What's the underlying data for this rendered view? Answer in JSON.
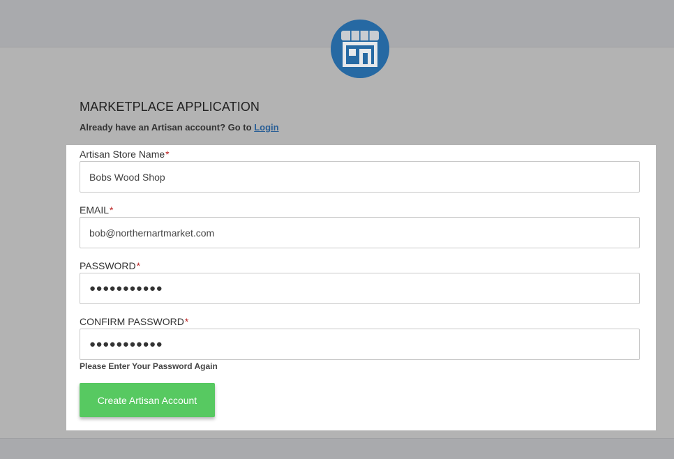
{
  "page": {
    "title": "MARKETPLACE APPLICATION",
    "login_prompt": "Already have an Artisan account? Go to",
    "login_link": "Login",
    "logo_icon": "storefront-icon"
  },
  "form": {
    "store_name": {
      "label": "Artisan Store Name",
      "required": "*",
      "value": "Bobs Wood Shop"
    },
    "email": {
      "label": "EMAIL",
      "required": "*",
      "value": "bob@northernartmarket.com"
    },
    "password": {
      "label": "PASSWORD",
      "required": "*",
      "value": "●●●●●●●●●●●"
    },
    "confirm_password": {
      "label": "CONFIRM PASSWORD",
      "required": "*",
      "value": "●●●●●●●●●●●",
      "hint": "Please Enter Your Password Again"
    },
    "submit_label": "Create Artisan Account"
  },
  "colors": {
    "logo_bg": "#2669a3",
    "submit_bg": "#57c961",
    "link": "#2a5f96",
    "required": "#b22222"
  }
}
